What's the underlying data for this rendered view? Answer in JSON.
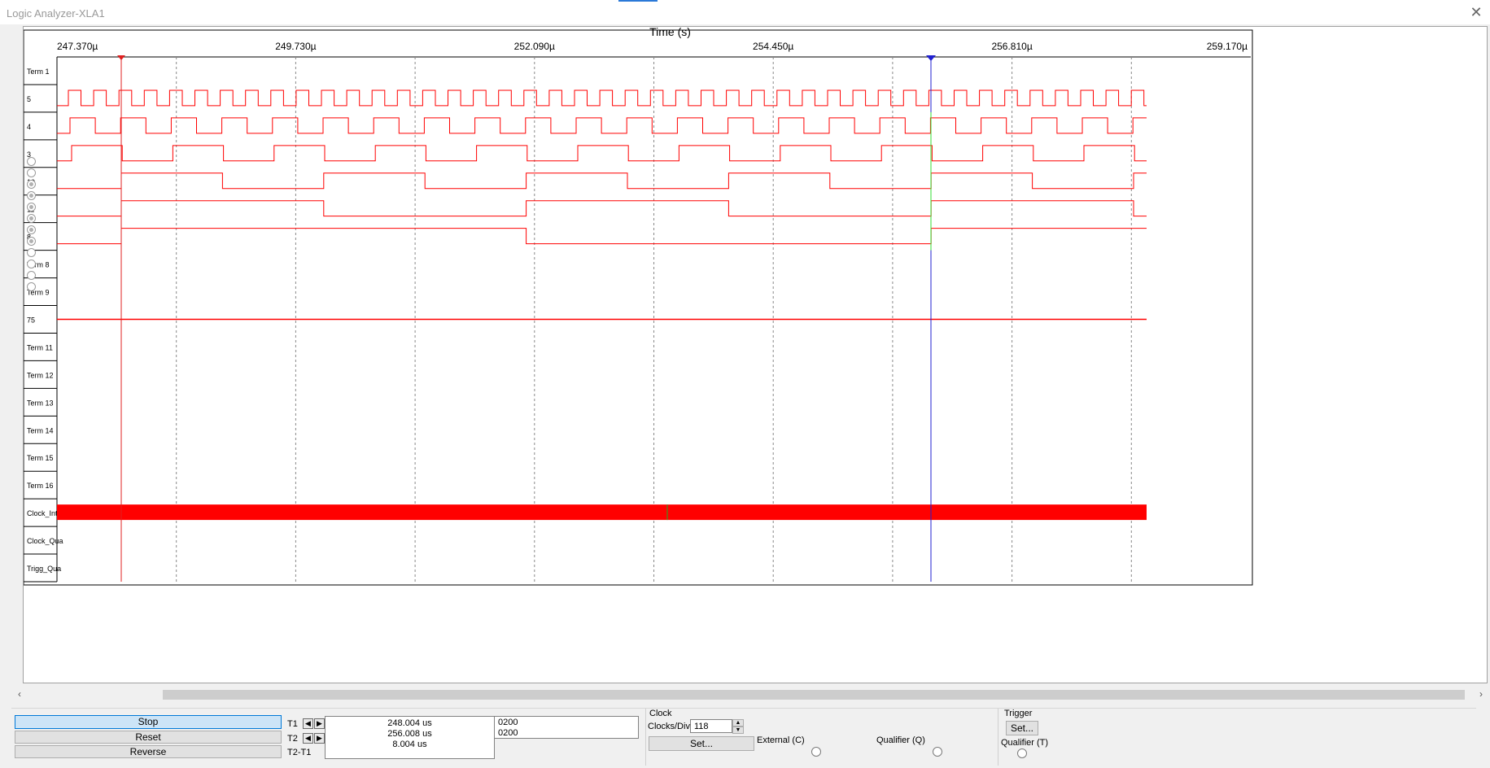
{
  "window": {
    "title": "Logic Analyzer-XLA1",
    "close_glyph": "✕"
  },
  "plot": {
    "xlabel": "Time (s)",
    "ticks": [
      "247.370µ",
      "249.730µ",
      "252.090µ",
      "254.450µ",
      "256.810µ",
      "259.170µ"
    ],
    "channels": [
      {
        "label": "Term 1",
        "wave": "none",
        "radio_on": false
      },
      {
        "label": "5",
        "wave": "clock",
        "radio_on": false
      },
      {
        "label": "4",
        "wave": "clock",
        "radio_on": false
      },
      {
        "label": "3",
        "wave": "clock",
        "radio_on": true
      },
      {
        "label": "10",
        "wave": "clock",
        "radio_on": true
      },
      {
        "label": "11",
        "wave": "clock",
        "radio_on": true
      },
      {
        "label": "8",
        "wave": "clock",
        "radio_on": true
      },
      {
        "label": "Term 8",
        "wave": "none",
        "radio_on": true
      },
      {
        "label": "Term 9",
        "wave": "none",
        "radio_on": true
      },
      {
        "label": "75",
        "wave": "flat-high",
        "radio_on": false
      },
      {
        "label": "Term 11",
        "wave": "none",
        "radio_on": false
      },
      {
        "label": "Term 12",
        "wave": "none",
        "radio_on": false
      },
      {
        "label": "Term 13",
        "wave": "none",
        "radio_on": false
      },
      {
        "label": "Term 14",
        "wave": "none",
        "radio_on": false
      },
      {
        "label": "Term 15",
        "wave": "none",
        "radio_on": false
      },
      {
        "label": "Term 16",
        "wave": "none",
        "radio_on": false
      },
      {
        "label": "Clock_Int",
        "wave": "solid",
        "radio_on": false
      },
      {
        "label": "Clock_Qua",
        "wave": "none",
        "radio_on": false
      },
      {
        "label": "Trigg_Qua",
        "wave": "none",
        "radio_on": false
      }
    ],
    "cursor_t1_color": "#e02020",
    "cursor_t2_color": "#2020d0",
    "trace_color": "#ff0000"
  },
  "controls": {
    "stop_label": "Stop",
    "reset_label": "Reset",
    "reverse_label": "Reverse",
    "t1_label": "T1",
    "t2_label": "T2",
    "t2t1_label": "T2-T1",
    "t1_value": "248.004 us",
    "t2_value": "256.008 us",
    "t2t1_value": "8.004 us",
    "t1_hex": "0200",
    "t2_hex": "0200",
    "clock_group": "Clock",
    "clocks_div_label": "Clocks/Div",
    "clocks_div_value": "118",
    "clock_set_label": "Set...",
    "external_label": "External (C)",
    "qualifier_q_label": "Qualifier (Q)",
    "trigger_group": "Trigger",
    "trigger_set_label": "Set...",
    "qualifier_t_label": "Qualifier (T)"
  }
}
